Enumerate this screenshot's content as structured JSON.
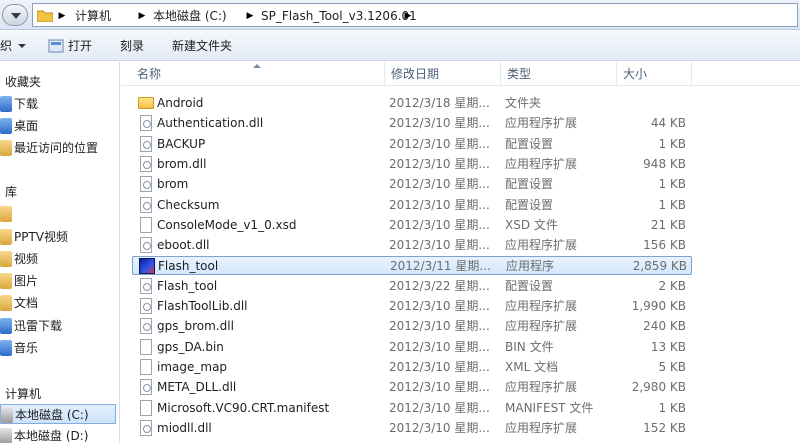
{
  "address": {
    "crumbs": [
      "计算机",
      "本地磁盘 (C:)",
      "SP_Flash_Tool_v3.1206.01"
    ]
  },
  "toolbar": {
    "organize_fragment": "织",
    "open_label": "打开",
    "burn_label": "刻录",
    "new_folder_label": "新建文件夹"
  },
  "sidebar": {
    "favorites_header": "收藏夹",
    "favorites": [
      {
        "label": "下载",
        "icon": "download-folder-icon"
      },
      {
        "label": "桌面",
        "icon": "desktop-icon"
      },
      {
        "label": "最近访问的位置",
        "icon": "recent-places-icon"
      }
    ],
    "libraries_header": "库",
    "libraries": [
      {
        "label": "PPTV视频",
        "icon": "video-library-icon"
      },
      {
        "label": "视频",
        "icon": "video-library-icon"
      },
      {
        "label": "图片",
        "icon": "pictures-library-icon"
      },
      {
        "label": "文档",
        "icon": "documents-library-icon"
      },
      {
        "label": "迅雷下载",
        "icon": "thunder-download-icon"
      },
      {
        "label": "音乐",
        "icon": "music-library-icon"
      }
    ],
    "computer_header": "计算机",
    "drives": [
      {
        "label": "本地磁盘 (C:)",
        "icon": "drive-icon",
        "selected": true
      },
      {
        "label": "本地磁盘 (D:)",
        "icon": "drive-icon",
        "selected": false
      }
    ]
  },
  "columns": {
    "name": "名称",
    "date": "修改日期",
    "type": "类型",
    "size": "大小"
  },
  "files": [
    {
      "name": "Android",
      "date": "2012/3/18 星期...",
      "type": "文件夹",
      "size": "",
      "icon": "folder-icon"
    },
    {
      "name": "Authentication.dll",
      "date": "2012/3/10 星期...",
      "type": "应用程序扩展",
      "size": "44 KB",
      "icon": "dll-icon"
    },
    {
      "name": "BACKUP",
      "date": "2012/3/10 星期...",
      "type": "配置设置",
      "size": "1 KB",
      "icon": "config-icon"
    },
    {
      "name": "brom.dll",
      "date": "2012/3/10 星期...",
      "type": "应用程序扩展",
      "size": "948 KB",
      "icon": "dll-icon"
    },
    {
      "name": "brom",
      "date": "2012/3/10 星期...",
      "type": "配置设置",
      "size": "1 KB",
      "icon": "config-icon"
    },
    {
      "name": "Checksum",
      "date": "2012/3/10 星期...",
      "type": "配置设置",
      "size": "1 KB",
      "icon": "config-icon"
    },
    {
      "name": "ConsoleMode_v1_0.xsd",
      "date": "2012/3/10 星期...",
      "type": "XSD 文件",
      "size": "21 KB",
      "icon": "document-icon"
    },
    {
      "name": "eboot.dll",
      "date": "2012/3/10 星期...",
      "type": "应用程序扩展",
      "size": "156 KB",
      "icon": "dll-icon"
    },
    {
      "name": "Flash_tool",
      "date": "2012/3/11 星期...",
      "type": "应用程序",
      "size": "2,859 KB",
      "icon": "application-icon",
      "selected": true
    },
    {
      "name": "Flash_tool",
      "date": "2012/3/22 星期...",
      "type": "配置设置",
      "size": "2 KB",
      "icon": "config-icon"
    },
    {
      "name": "FlashToolLib.dll",
      "date": "2012/3/10 星期...",
      "type": "应用程序扩展",
      "size": "1,990 KB",
      "icon": "dll-icon"
    },
    {
      "name": "gps_brom.dll",
      "date": "2012/3/10 星期...",
      "type": "应用程序扩展",
      "size": "240 KB",
      "icon": "dll-icon"
    },
    {
      "name": "gps_DA.bin",
      "date": "2012/3/10 星期...",
      "type": "BIN 文件",
      "size": "13 KB",
      "icon": "document-icon"
    },
    {
      "name": "image_map",
      "date": "2012/3/10 星期...",
      "type": "XML 文档",
      "size": "5 KB",
      "icon": "document-icon"
    },
    {
      "name": "META_DLL.dll",
      "date": "2012/3/10 星期...",
      "type": "应用程序扩展",
      "size": "2,980 KB",
      "icon": "dll-icon"
    },
    {
      "name": "Microsoft.VC90.CRT.manifest",
      "date": "2012/3/10 星期...",
      "type": "MANIFEST 文件",
      "size": "1 KB",
      "icon": "document-icon"
    },
    {
      "name": "miodll.dll",
      "date": "2012/3/10 星期...",
      "type": "应用程序扩展",
      "size": "152 KB",
      "icon": "dll-icon"
    }
  ]
}
